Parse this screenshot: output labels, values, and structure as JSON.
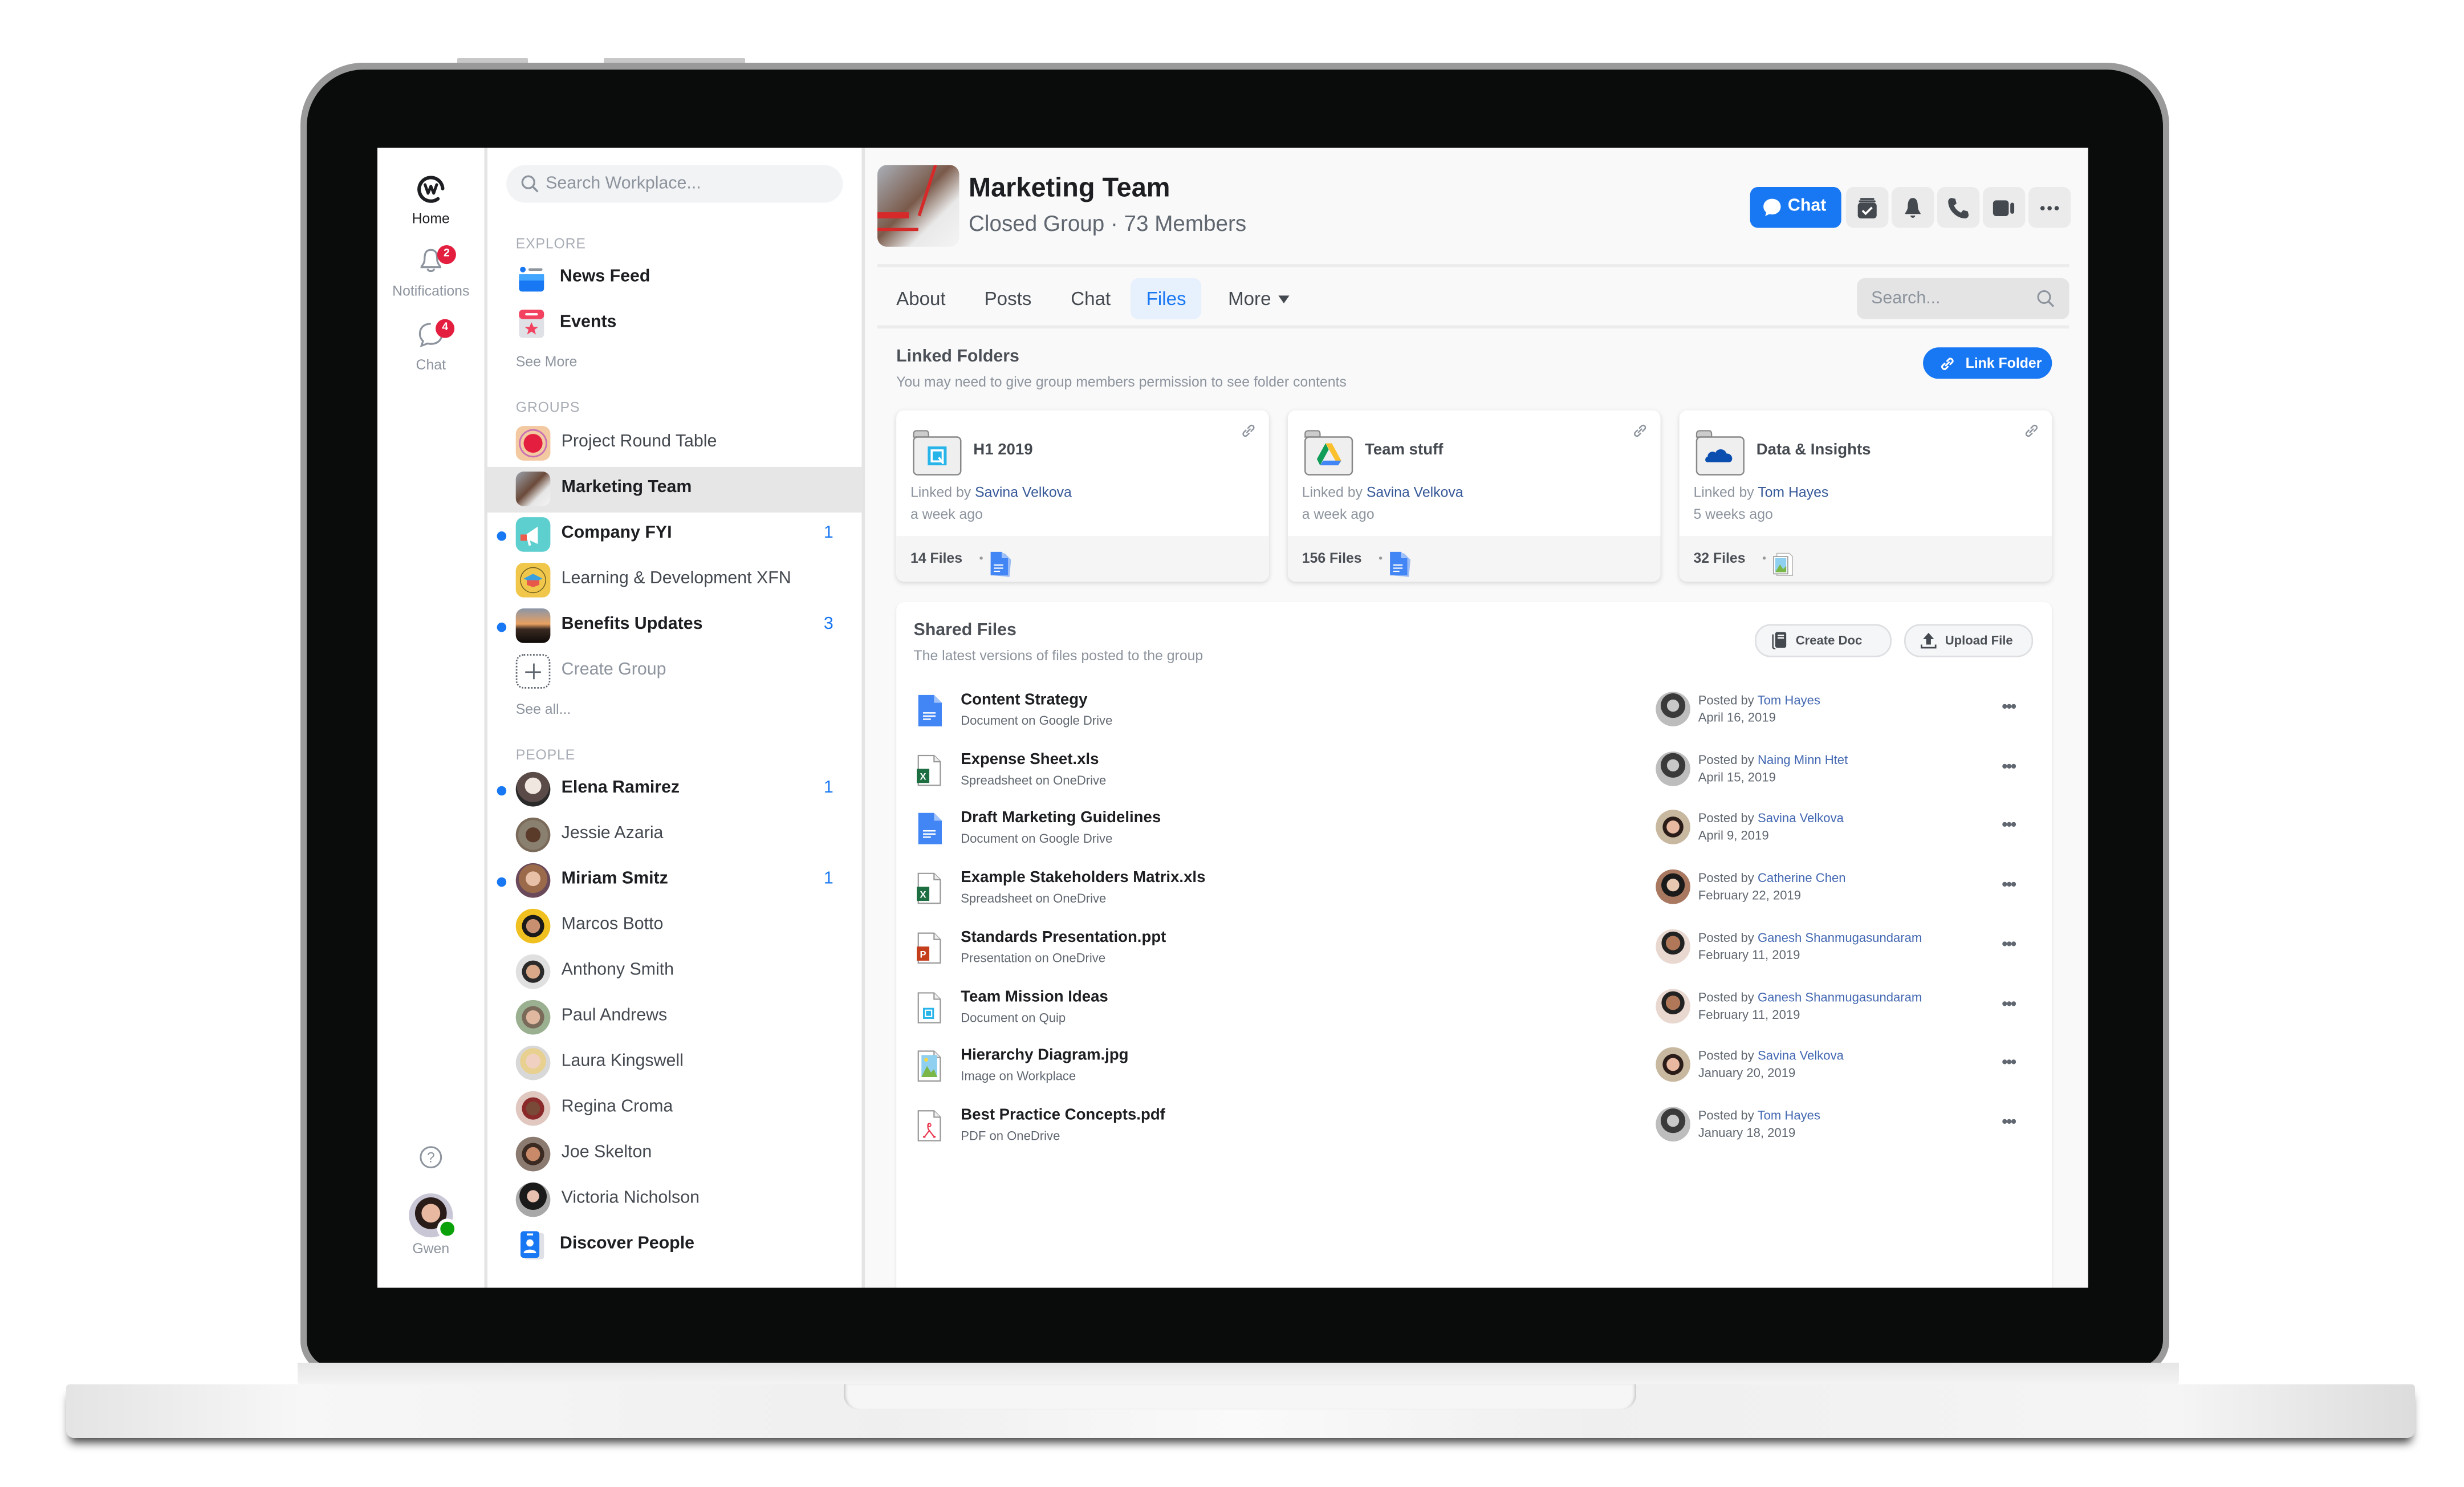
{
  "rail": {
    "home_label": "Home",
    "notifications_label": "Notifications",
    "notifications_badge": "2",
    "chat_label": "Chat",
    "chat_badge": "4",
    "user_name": "Gwen",
    "help_icon": "question-circle-icon"
  },
  "nav": {
    "search_placeholder": "Search Workplace...",
    "explore_heading": "EXPLORE",
    "explore_items": [
      {
        "label": "News Feed",
        "icon": "news-feed-icon"
      },
      {
        "label": "Events",
        "icon": "events-icon"
      }
    ],
    "see_more": "See More",
    "groups_heading": "GROUPS",
    "groups": [
      {
        "label": "Project Round Table",
        "unread": false,
        "count": ""
      },
      {
        "label": "Marketing Team",
        "unread": false,
        "count": "",
        "selected": true
      },
      {
        "label": "Company FYI",
        "unread": true,
        "count": "1"
      },
      {
        "label": "Learning & Development XFN",
        "unread": false,
        "count": ""
      },
      {
        "label": "Benefits Updates",
        "unread": true,
        "count": "3"
      }
    ],
    "create_group": "Create Group",
    "see_all": "See all...",
    "people_heading": "PEOPLE",
    "people": [
      {
        "label": "Elena Ramirez",
        "unread": true,
        "count": "1"
      },
      {
        "label": "Jessie Azaria",
        "unread": false,
        "count": ""
      },
      {
        "label": "Miriam Smitz",
        "unread": true,
        "count": "1"
      },
      {
        "label": "Marcos Botto",
        "unread": false,
        "count": ""
      },
      {
        "label": "Anthony Smith",
        "unread": false,
        "count": ""
      },
      {
        "label": "Paul Andrews",
        "unread": false,
        "count": ""
      },
      {
        "label": "Laura Kingswell",
        "unread": false,
        "count": ""
      },
      {
        "label": "Regina Croma",
        "unread": false,
        "count": ""
      },
      {
        "label": "Joe Skelton",
        "unread": false,
        "count": ""
      },
      {
        "label": "Victoria Nicholson",
        "unread": false,
        "count": ""
      }
    ],
    "discover_people": "Discover People"
  },
  "group": {
    "title": "Marketing Team",
    "subtitle": "Closed Group · 73 Members",
    "chat_button": "Chat",
    "actions": [
      "mark-read-icon",
      "bell-icon",
      "phone-icon",
      "video-icon",
      "more-icon"
    ],
    "tabs": [
      "About",
      "Posts",
      "Chat",
      "Files",
      "More"
    ],
    "active_tab": "Files",
    "search_placeholder": "Search..."
  },
  "linked_folders": {
    "title": "Linked Folders",
    "subtitle": "You may need to give group members permission to see folder contents",
    "link_button": "Link Folder",
    "linked_by_prefix": "Linked by ",
    "folders": [
      {
        "name": "H1 2019",
        "service": "quip",
        "linked_by": "Savina Velkova",
        "ago": "a week ago",
        "files": "14 Files"
      },
      {
        "name": "Team stuff",
        "service": "google-drive",
        "linked_by": "Savina Velkova",
        "ago": "a week ago",
        "files": "156 Files"
      },
      {
        "name": "Data & Insights",
        "service": "onedrive",
        "linked_by": "Tom Hayes",
        "ago": "5 weeks ago",
        "files": "32 Files"
      }
    ]
  },
  "shared_files": {
    "title": "Shared Files",
    "subtitle": "The latest versions of files posted to the group",
    "create_doc": "Create Doc",
    "upload_file": "Upload File",
    "posted_by_prefix": "Posted by ",
    "files": [
      {
        "name": "Content Strategy",
        "source": "Document on Google Drive",
        "type": "gdoc",
        "poster": "Tom Hayes",
        "date": "April 16, 2019"
      },
      {
        "name": "Expense Sheet.xls",
        "source": "Spreadsheet on OneDrive",
        "type": "xls",
        "poster": "Naing Minn Htet",
        "date": "April 15, 2019"
      },
      {
        "name": "Draft Marketing Guidelines",
        "source": "Document on Google Drive",
        "type": "gdoc",
        "poster": "Savina Velkova",
        "date": "April 9, 2019"
      },
      {
        "name": "Example Stakeholders Matrix.xls",
        "source": "Spreadsheet on OneDrive",
        "type": "xls",
        "poster": "Catherine Chen",
        "date": "February 22, 2019"
      },
      {
        "name": "Standards Presentation.ppt",
        "source": "Presentation on OneDrive",
        "type": "ppt",
        "poster": "Ganesh Shanmugasundaram",
        "date": "February 11, 2019"
      },
      {
        "name": "Team Mission Ideas",
        "source": "Document on Quip",
        "type": "quip",
        "poster": "Ganesh Shanmugasundaram",
        "date": "February 11, 2019"
      },
      {
        "name": "Hierarchy Diagram.jpg",
        "source": "Image on Workplace",
        "type": "jpg",
        "poster": "Savina Velkova",
        "date": "January 20, 2019"
      },
      {
        "name": "Best Practice Concepts.pdf",
        "source": "PDF on OneDrive",
        "type": "pdf",
        "poster": "Tom Hayes",
        "date": "January 18, 2019"
      }
    ]
  },
  "colors": {
    "accent": "#1877f2",
    "badge": "#e41e3f",
    "link": "#365899",
    "online": "#0ba10b"
  }
}
